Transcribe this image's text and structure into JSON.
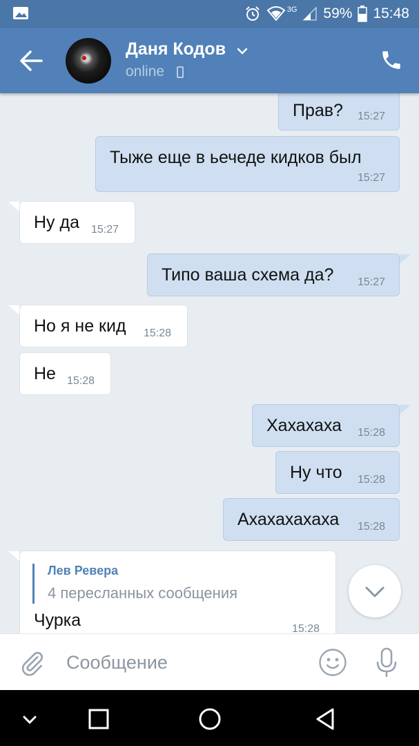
{
  "status_bar": {
    "network": "3G",
    "battery": "59%",
    "time": "15:48"
  },
  "header": {
    "contact_name": "Даня Кодов",
    "status": "online"
  },
  "messages": [
    {
      "dir": "out",
      "text": "Прав?",
      "time": "15:27"
    },
    {
      "dir": "out",
      "text": "Тыже еще в ьечеде кидков был",
      "time": "15:27"
    },
    {
      "dir": "in",
      "text": "Ну да",
      "time": "15:27"
    },
    {
      "dir": "out",
      "text": "Типо ваша схема да?",
      "time": "15:27"
    },
    {
      "dir": "in",
      "text": "Но я не кид",
      "time": "15:28"
    },
    {
      "dir": "in",
      "text": "Не",
      "time": "15:28"
    },
    {
      "dir": "out",
      "text": "Хахахаха",
      "time": "15:28"
    },
    {
      "dir": "out",
      "text": "Ну что",
      "time": "15:28"
    },
    {
      "dir": "out",
      "text": "Ахахахахаха",
      "time": "15:28"
    }
  ],
  "forwarded": {
    "author": "Лев Ревера",
    "count_label": "4 пересланных сообщения",
    "text": "Чурка",
    "time": "15:28"
  },
  "composer": {
    "placeholder": "Сообщение"
  },
  "colors": {
    "header": "#5181b8",
    "status_bar": "#4a76a8",
    "chat_bg": "#e8edf2",
    "outgoing_bubble": "#cfdff1",
    "incoming_bubble": "#ffffff",
    "accent": "#5181b8"
  },
  "icons": [
    "gallery-icon",
    "alarm-icon",
    "wifi-icon",
    "signal-icon",
    "battery-icon",
    "back-arrow-icon",
    "chevron-down-icon",
    "phone-icon",
    "call-icon",
    "attach-icon",
    "emoji-icon",
    "mic-icon",
    "nav-back-icon",
    "nav-home-icon",
    "nav-recents-icon",
    "nav-dropdown-icon"
  ]
}
